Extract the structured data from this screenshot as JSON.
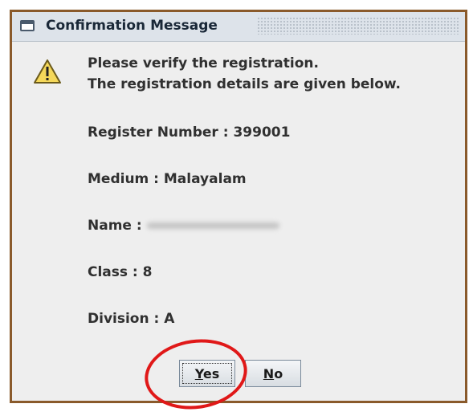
{
  "dialog": {
    "title": "Confirmation Message",
    "icon": "window-icon",
    "warning_icon": "warning-icon",
    "messages": [
      "Please verify the registration.",
      "The registration details are given below."
    ],
    "details": [
      "Register Number : 399001",
      "Medium : Malayalam",
      "Name :",
      "Class : 8",
      "Division : A"
    ],
    "buttons": {
      "yes_first": "Y",
      "yes_rest": "es",
      "no_first": "N",
      "no_rest": "o"
    },
    "highlight_color": "#e01818"
  }
}
